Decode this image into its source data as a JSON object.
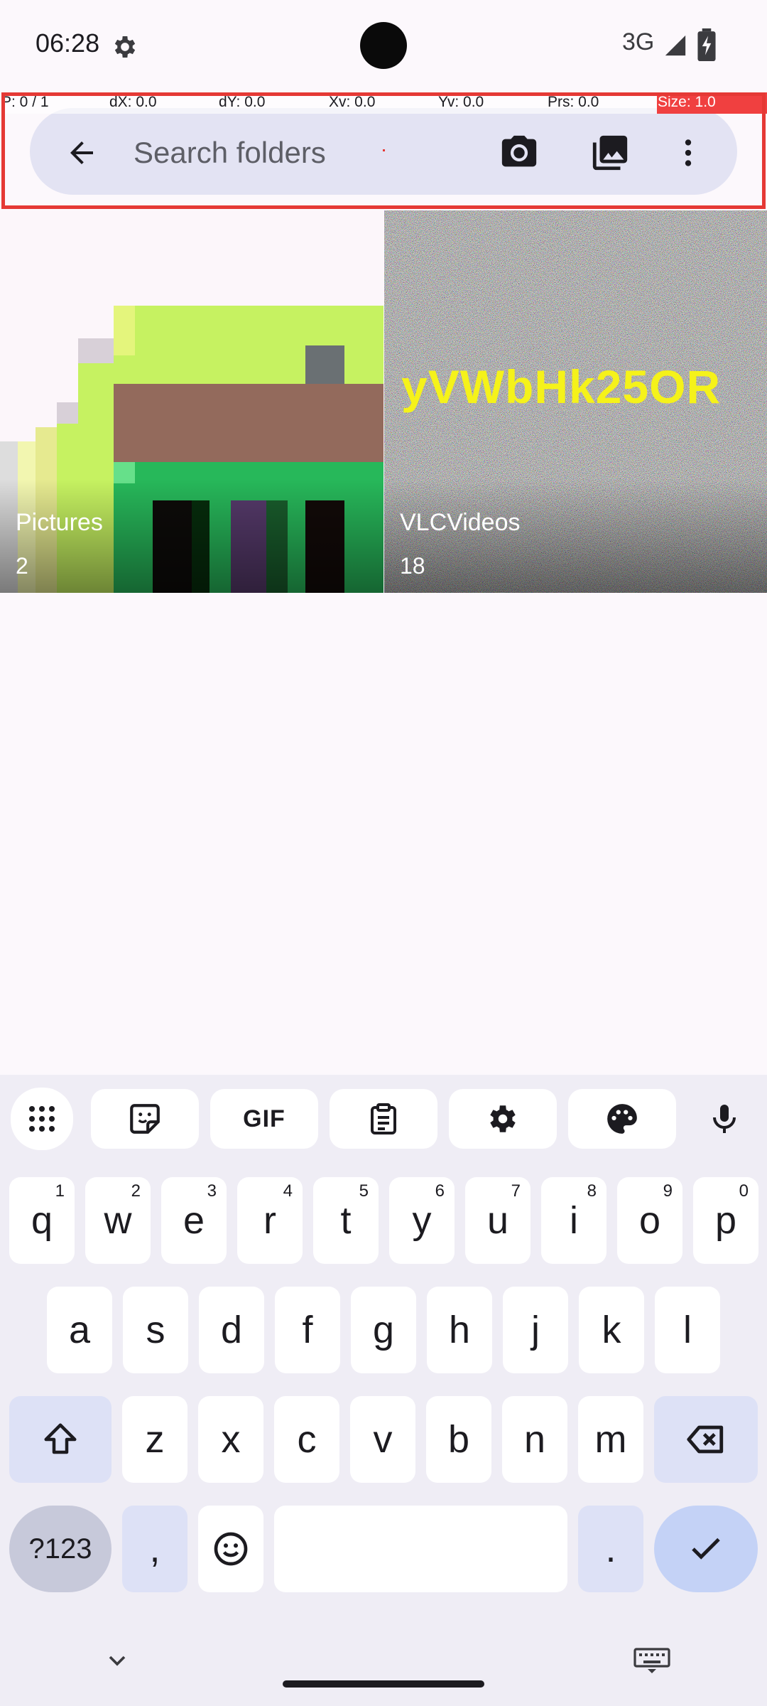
{
  "status_bar": {
    "time": "06:28",
    "network": "3G",
    "icons": [
      "settings-gear-icon",
      "signal-icon",
      "battery-icon"
    ]
  },
  "pointer_overlay": {
    "p": "P: 0 / 1",
    "dx": "dX: 0.0",
    "dy": "dY: 0.0",
    "xv": "Xv: 0.0",
    "yv": "Yv: 0.0",
    "prs": "Prs: 0.0",
    "size": "Size: 1.0"
  },
  "search": {
    "placeholder": "Search folders",
    "value": ""
  },
  "toolbar": {
    "icons": [
      "back-arrow-icon",
      "camera-icon",
      "gallery-icon",
      "more-vert-icon"
    ]
  },
  "folders": [
    {
      "name": "Pictures",
      "count": "2"
    },
    {
      "name": "VLCVideos",
      "count": "18",
      "thumbnail_text": "yVWbHk25OR"
    }
  ],
  "keyboard": {
    "toolbar": [
      "apps-grid-icon",
      "sticker-icon",
      "GIF",
      "clipboard-icon",
      "settings-icon",
      "palette-icon",
      "mic-icon"
    ],
    "gif_label": "GIF",
    "row1": [
      {
        "key": "q",
        "hint": "1"
      },
      {
        "key": "w",
        "hint": "2"
      },
      {
        "key": "e",
        "hint": "3"
      },
      {
        "key": "r",
        "hint": "4"
      },
      {
        "key": "t",
        "hint": "5"
      },
      {
        "key": "y",
        "hint": "6"
      },
      {
        "key": "u",
        "hint": "7"
      },
      {
        "key": "i",
        "hint": "8"
      },
      {
        "key": "o",
        "hint": "9"
      },
      {
        "key": "p",
        "hint": "0"
      }
    ],
    "row2": [
      "a",
      "s",
      "d",
      "f",
      "g",
      "h",
      "j",
      "k",
      "l"
    ],
    "row3": [
      "z",
      "x",
      "c",
      "v",
      "b",
      "n",
      "m"
    ],
    "sym_label": "?123",
    "comma_label": ",",
    "period_label": ".",
    "colors": {
      "background": "#efedf5",
      "key": "#ffffff",
      "mod_key": "#dde1f6",
      "enter": "#c4d2f6"
    }
  },
  "theme": {
    "accent": "#e3e3f3",
    "overlay_red": "#e53935"
  }
}
